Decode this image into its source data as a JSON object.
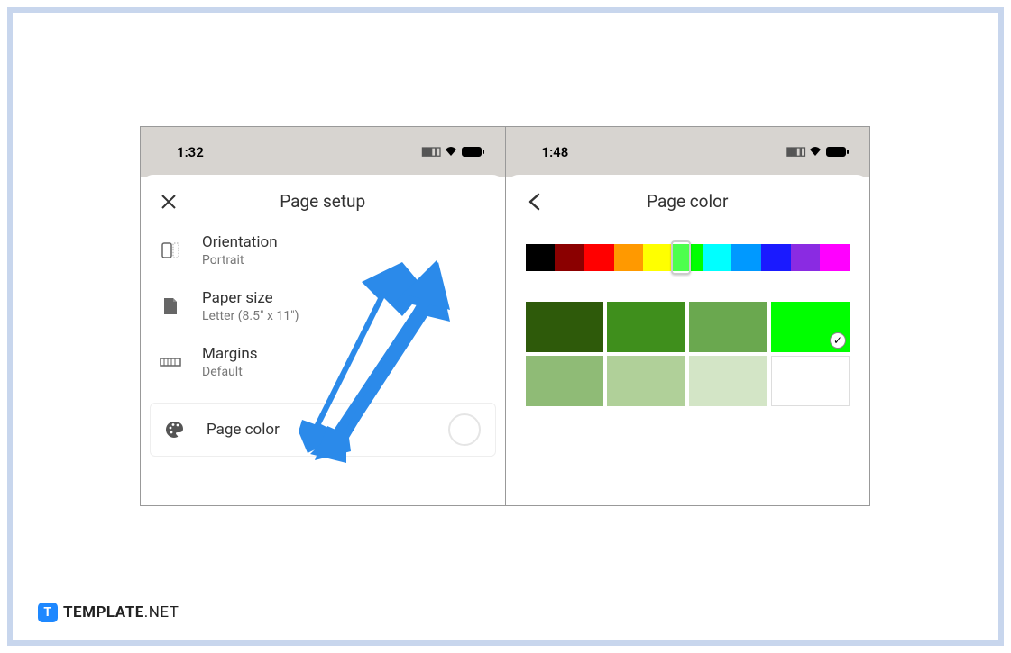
{
  "footer": {
    "brand_bold": "TEMPLATE",
    "brand_light": ".NET",
    "badge_letter": "T"
  },
  "left": {
    "time": "1:32",
    "sheet_title": "Page setup",
    "items": {
      "orientation": {
        "title": "Orientation",
        "sub": "Portrait"
      },
      "paper_size": {
        "title": "Paper size",
        "sub": "Letter (8.5\" x 11\")"
      },
      "margins": {
        "title": "Margins",
        "sub": "Default"
      },
      "page_color": {
        "title": "Page color"
      }
    }
  },
  "right": {
    "time": "1:48",
    "sheet_title": "Page color",
    "spectrum_colors": [
      "#000000",
      "#8b0000",
      "#ff0000",
      "#ff9900",
      "#ffff00",
      "#00ff00",
      "#00ffff",
      "#0099ff",
      "#1a1aff",
      "#8a2be2",
      "#ff00ff"
    ],
    "slider_position_pct": 48,
    "shades": [
      {
        "hex": "#2e5a0a",
        "selected": false
      },
      {
        "hex": "#3f8f1c",
        "selected": false
      },
      {
        "hex": "#6aa84f",
        "selected": false
      },
      {
        "hex": "#00ff00",
        "selected": true
      },
      {
        "hex": "#8fbb76",
        "selected": false
      },
      {
        "hex": "#b0d099",
        "selected": false
      },
      {
        "hex": "#d3e5c6",
        "selected": false
      },
      {
        "hex": "#ffffff",
        "selected": false
      }
    ]
  },
  "arrow_color": "#2b8aea"
}
